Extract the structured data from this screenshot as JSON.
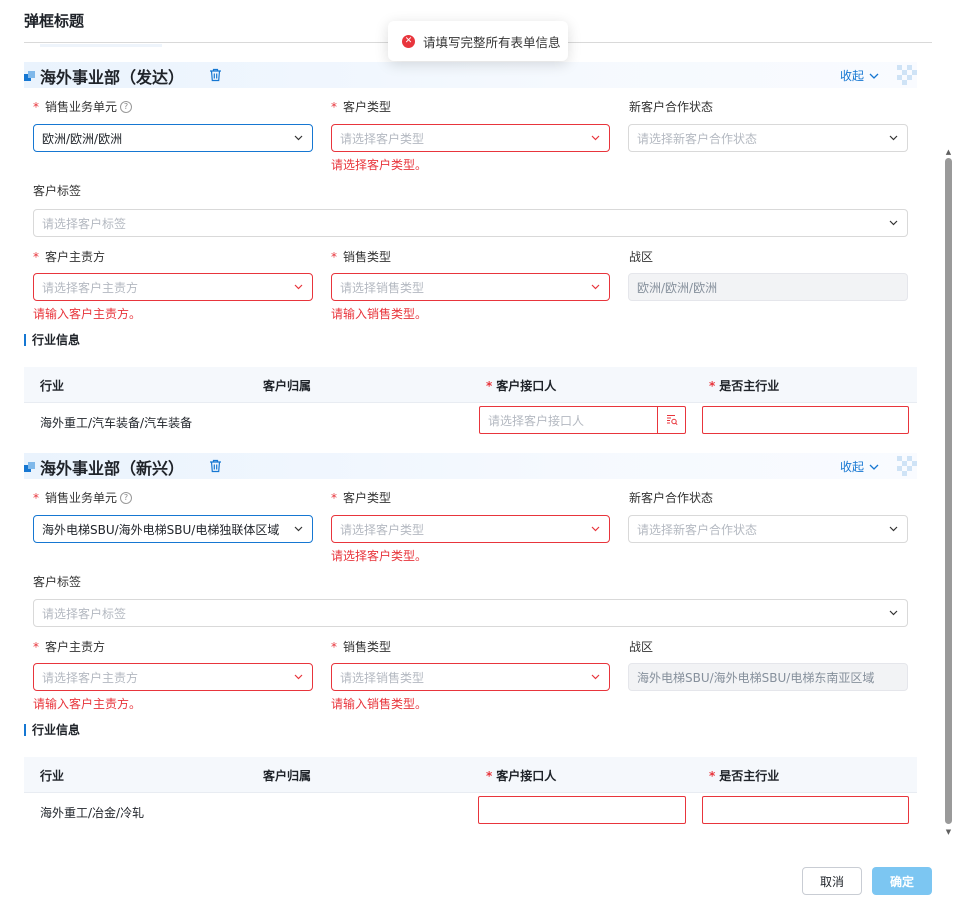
{
  "modal": {
    "title": "弹框标题"
  },
  "toast": {
    "message": "请填写完整所有表单信息"
  },
  "labels": {
    "sales_unit": "销售业务单元",
    "customer_type": "客户类型",
    "new_coop_status": "新客户合作状态",
    "customer_tag": "客户标签",
    "customer_owner": "客户主责方",
    "sales_type": "销售类型",
    "war_zone": "战区",
    "industry_info": "行业信息",
    "collapse": "收起"
  },
  "placeholders": {
    "customer_type": "请选择客户类型",
    "new_coop_status": "请选择新客户合作状态",
    "customer_tag": "请选择客户标签",
    "customer_owner": "请选择客户主责方",
    "sales_type": "请选择销售类型",
    "contact": "请选择客户接口人"
  },
  "errors": {
    "customer_type": "请选择客户类型。",
    "customer_owner": "请输入客户主责方。",
    "sales_type": "请输入销售类型。"
  },
  "table_headers": [
    "行业",
    "客户归属",
    "客户接口人",
    "是否主行业"
  ],
  "sections": [
    {
      "title": "海外事业部（发达）",
      "sales_unit_value": "欧洲/欧洲/欧洲",
      "war_zone_value": "欧洲/欧洲/欧洲",
      "industry_row": {
        "industry": "海外重工/汽车装备/汽车装备",
        "ownership": ""
      }
    },
    {
      "title": "海外事业部（新兴）",
      "sales_unit_value": "海外电梯SBU/海外电梯SBU/电梯独联体区域",
      "war_zone_value": "海外电梯SBU/海外电梯SBU/电梯东南亚区域",
      "industry_row": {
        "industry": "海外重工/冶金/冷轧",
        "ownership": ""
      }
    }
  ],
  "footer": {
    "cancel": "取消",
    "ok": "确定"
  },
  "colors": {
    "accent": "#1677d2",
    "error": "#e8353c",
    "primary_disabled": "#7cc6f2"
  }
}
